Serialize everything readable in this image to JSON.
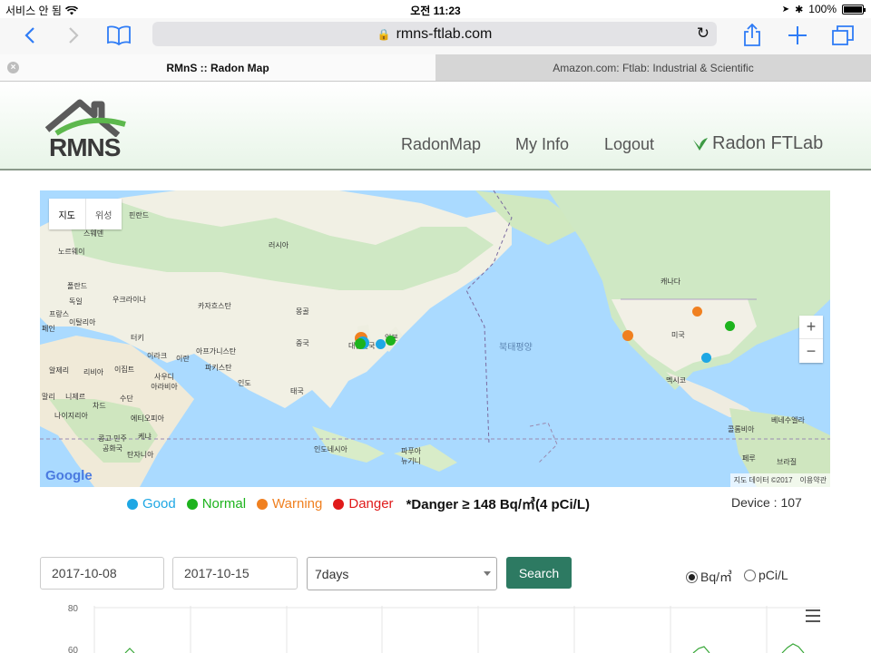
{
  "status_bar": {
    "carrier": "서비스 안 됨",
    "time": "오전 11:23",
    "battery": "100%",
    "battery_level": 1.0
  },
  "browser": {
    "url": "rmns-ftlab.com",
    "tabs": [
      {
        "title": "RMnS :: Radon Map",
        "active": true
      },
      {
        "title": "Amazon.com: Ftlab: Industrial & Scientific",
        "active": false
      }
    ]
  },
  "header": {
    "logo_text": "RMNS",
    "nav": [
      "RadonMap",
      "My Info",
      "Logout"
    ],
    "brand": "Radon FTLab"
  },
  "map": {
    "toggle": [
      "지도",
      "위성"
    ],
    "labels": {
      "sweden": "스웨덴",
      "norway": "노르웨이",
      "finland": "핀란드",
      "russia": "러시아",
      "poland": "폴란드",
      "germany": "독일",
      "ukraine": "우크라이나",
      "france": "프랑스",
      "italy": "이탈리아",
      "spain": "페인",
      "kazakhstan": "카자흐스탄",
      "mongolia": "몽골",
      "turkey": "터키",
      "china": "중국",
      "iran": "이란",
      "afghanistan": "아프가니스탄",
      "pakistan": "파키스탄",
      "iraq": "이라크",
      "algeria": "알제리",
      "libya": "리비아",
      "egypt": "이집트",
      "saudi": "사우디\n아라비아",
      "india": "인도",
      "thailand": "태국",
      "mali": "말리",
      "niger": "니제르",
      "chad": "차드",
      "sudan": "수단",
      "nigeria": "나이지리아",
      "ethiopia": "에티오피아",
      "kenya": "케냐",
      "congo": "콩고 민주\n공화국",
      "tanzania": "탄자니아",
      "indonesia": "인도네시아",
      "png": "파푸아\n뉴기니",
      "korea": "대한민국",
      "japan": "일본",
      "pacific": "북태평양",
      "canada": "캐나다",
      "usa": "미국",
      "mexico": "멕시코",
      "venezuela": "베네수엘라",
      "colombia": "콜롬비아",
      "peru": "페루",
      "brazil": "브라질"
    },
    "attribution": [
      "지도 데이터 ©2017",
      "이용약관"
    ],
    "google": "Google",
    "zoom_in": "+",
    "zoom_out": "−"
  },
  "legend": {
    "items": [
      {
        "label": "Good",
        "color": "#1ea7e4"
      },
      {
        "label": "Normal",
        "color": "#1db31d"
      },
      {
        "label": "Warning",
        "color": "#f08020"
      },
      {
        "label": "Danger",
        "color": "#e01a1a"
      }
    ],
    "note": "*Danger ≥ 148 Bq/㎥(4 pCi/L)",
    "device": "Device : 107"
  },
  "filters": {
    "start_date": "2017-10-08",
    "end_date": "2017-10-15",
    "period": "7days",
    "search": "Search",
    "units": [
      {
        "label": "Bq/㎥",
        "selected": true
      },
      {
        "label": "pCi/L",
        "selected": false
      }
    ]
  },
  "chart": {
    "y_tick_top": "80",
    "y_tick_next": "60"
  }
}
